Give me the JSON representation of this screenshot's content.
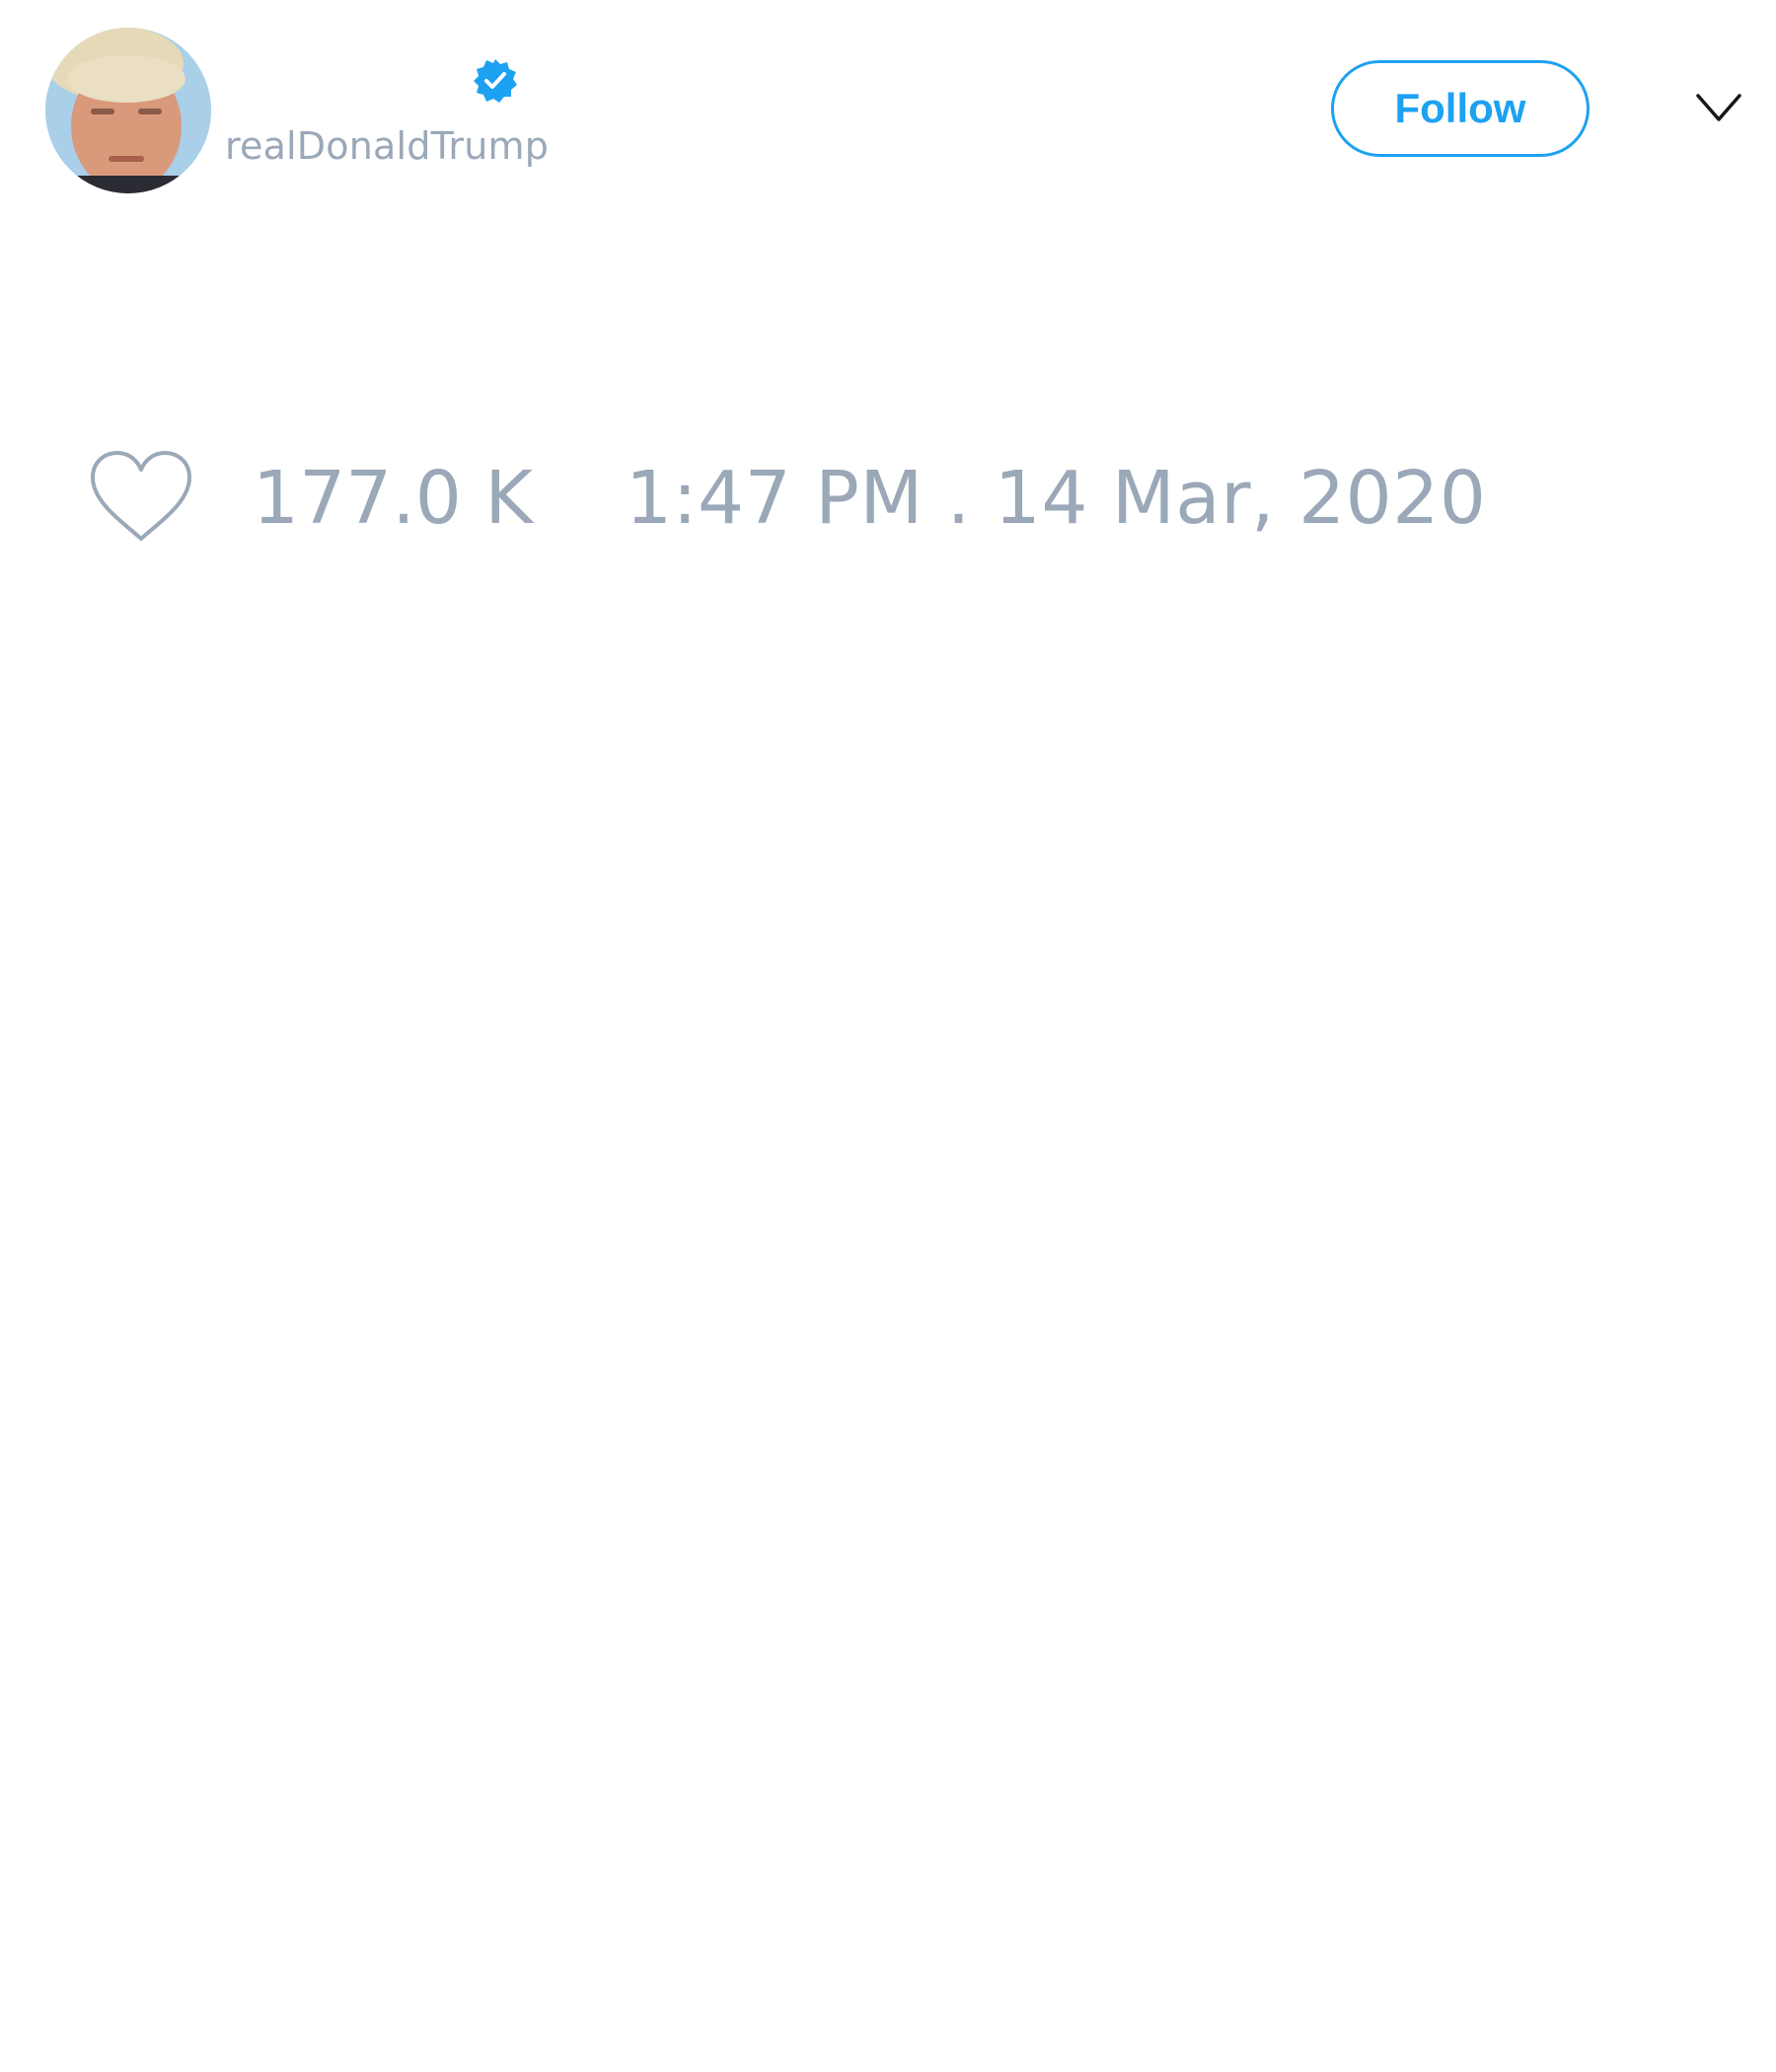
{
  "tweet": {
    "author": {
      "display_name": "",
      "handle": "realDonaldTrump",
      "verified": true,
      "avatar_icon": "profile-photo"
    },
    "follow_label": "Follow",
    "menu_icon": "chevron-down-icon",
    "likes": {
      "icon": "heart-outline-icon",
      "count": "177.0 K"
    },
    "timestamp": "1:47 PM . 14 Mar, 2020"
  },
  "colors": {
    "accent": "#1da1f2",
    "muted_text": "#9aa8b8",
    "background": "#ffffff"
  }
}
